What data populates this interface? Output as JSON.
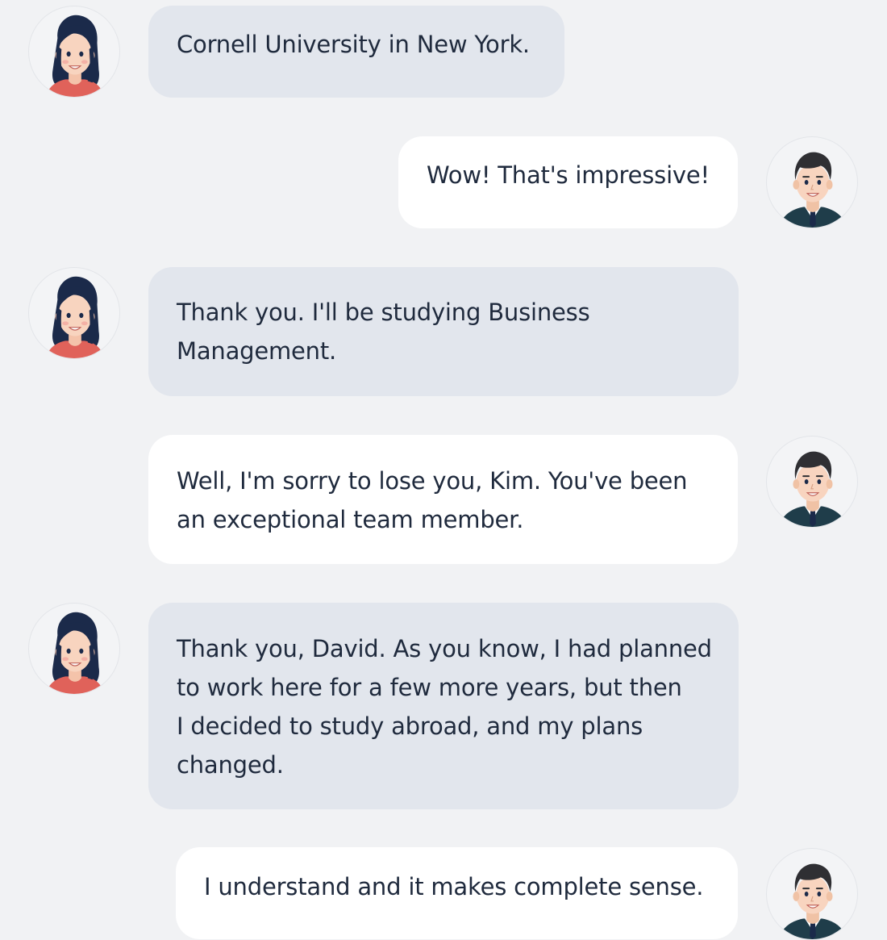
{
  "conversation": {
    "messages": [
      {
        "speaker": "woman",
        "lines": [
          "Cornell University in New York."
        ]
      },
      {
        "speaker": "man",
        "lines": [
          "Wow! That's impressive!"
        ]
      },
      {
        "speaker": "woman",
        "lines": [
          "Thank you. I'll be studying Business",
          "Management."
        ]
      },
      {
        "speaker": "man",
        "lines": [
          "Well, I'm sorry to lose you, Kim. You've been",
          "an exceptional team member."
        ]
      },
      {
        "speaker": "woman",
        "lines": [
          "Thank you, David. As you know, I had planned",
          "to work here for a few more years, but then",
          "I decided to study abroad, and my plans",
          "changed."
        ]
      },
      {
        "speaker": "man",
        "lines": [
          "I understand and it makes complete sense."
        ]
      }
    ]
  },
  "avatars": {
    "woman": "woman-avatar-icon",
    "man": "man-avatar-icon"
  },
  "colors": {
    "background": "#f1f2f4",
    "her_bubble": "#e2e6ed",
    "his_bubble": "#ffffff",
    "text": "#1f2a3d"
  }
}
